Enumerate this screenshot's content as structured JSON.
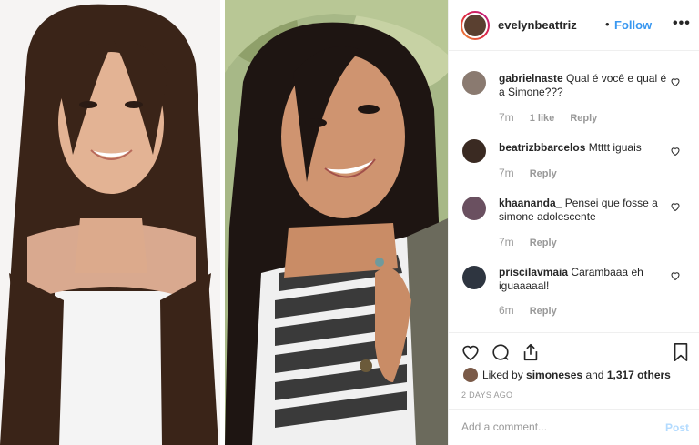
{
  "header": {
    "username": "evelynbeattriz",
    "separator": "•",
    "follow_label": "Follow",
    "more_icon": "more-options-icon"
  },
  "comments": [
    {
      "username": "gabrielnaste",
      "text": "Qual é você e qual é a Simone???",
      "time": "7m",
      "likes": "1 like",
      "reply": "Reply",
      "avatar_color": "#8a7a70"
    },
    {
      "username": "beatrizbbarcelos",
      "text": "Mtttt iguais",
      "time": "7m",
      "likes": "",
      "reply": "Reply",
      "avatar_color": "#3a2a22"
    },
    {
      "username": "khaananda_",
      "text": "Pensei que fosse a simone adolescente",
      "time": "7m",
      "likes": "",
      "reply": "Reply",
      "avatar_color": "#6a5060"
    },
    {
      "username": "priscilavmaia",
      "text": "Carambaaa eh iguaaaaal!",
      "time": "6m",
      "likes": "",
      "reply": "Reply",
      "avatar_color": "#2e3540"
    }
  ],
  "actions": {
    "like_icon": "heart-icon",
    "comment_icon": "comment-icon",
    "share_icon": "share-icon",
    "save_icon": "bookmark-icon"
  },
  "likes": {
    "prefix": "Liked by",
    "user": "simoneses",
    "joiner": "and",
    "others": "1,317 others"
  },
  "date": "2 DAYS AGO",
  "add_comment": {
    "placeholder": "Add a comment...",
    "post_label": "Post"
  },
  "colors": {
    "accent": "#3897f0",
    "post_disabled": "#b3dbff",
    "muted": "#999999"
  }
}
